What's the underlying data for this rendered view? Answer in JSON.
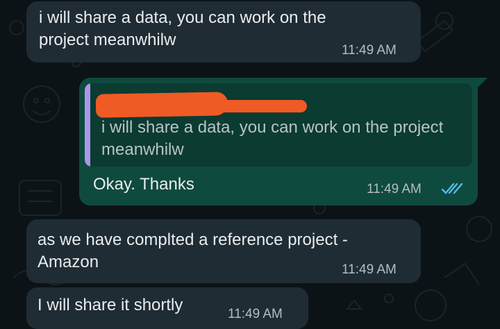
{
  "messages": [
    {
      "id": "m1",
      "direction": "incoming",
      "text": "i will share a data, you can work on the\nproject meanwhilw",
      "time": "11:49 AM"
    },
    {
      "id": "m2",
      "direction": "outgoing",
      "quote": {
        "author": "",
        "text": "i will share a data, you can work on the\nproject meanwhilw"
      },
      "text": "Okay. Thanks",
      "time": "11:49 AM",
      "status": "read",
      "status_icon": "double-check-icon"
    },
    {
      "id": "m3",
      "direction": "incoming",
      "text": "as we have complted a reference project -\nAmazon",
      "time": "11:49 AM"
    },
    {
      "id": "m4",
      "direction": "incoming",
      "text": "I will share it shortly",
      "time": "11:49 AM"
    }
  ],
  "colors": {
    "background": "#0c1317",
    "incoming_bubble": "#202c33",
    "outgoing_bubble": "#0f4a3e",
    "quote_accent": "#a997e9",
    "read_ticks": "#53bdeb",
    "redaction": "#f05a24"
  }
}
